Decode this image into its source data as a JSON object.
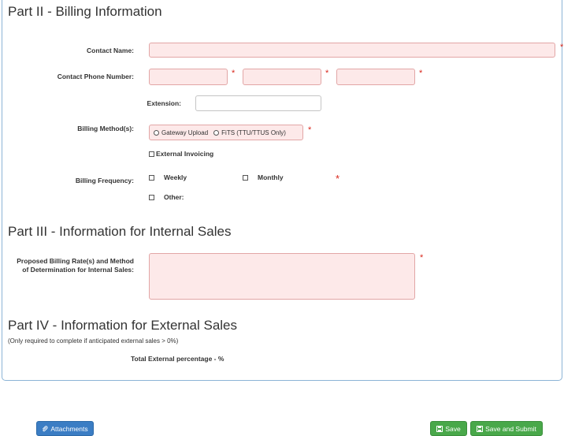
{
  "part2": {
    "title": "Part II - Billing Information",
    "contact_name_label": "Contact Name:",
    "contact_phone_label": "Contact Phone Number:",
    "extension_label": "Extension:",
    "billing_method_label": "Billing Method(s):",
    "billing_methods": [
      "Gateway Upload",
      "FiTS (TTU/TTUS Only)"
    ],
    "external_invoicing_label": "External Invoicing",
    "billing_frequency_label": "Billing Frequency:",
    "frequency_options": [
      "Weekly",
      "Monthly",
      "Other:"
    ],
    "required_mark": "*"
  },
  "part3": {
    "title": "Part III - Information for Internal Sales",
    "rate_label_line1": "Proposed Billing Rate(s) and Method",
    "rate_label_line2": "of Determination for Internal Sales:"
  },
  "part4": {
    "title": "Part IV - Information for External Sales",
    "note": "(Only required to complete if anticipated external sales > 0%)",
    "total_label": "Total External percentage - %"
  },
  "footer": {
    "attachments_label": "Attachments",
    "save_label": "Save",
    "save_submit_label": "Save and Submit"
  },
  "colors": {
    "required_field_bg": "#fde9e9",
    "required_star": "#d9271c",
    "primary_button": "#3b7dc4",
    "success_button": "#49a84a"
  }
}
